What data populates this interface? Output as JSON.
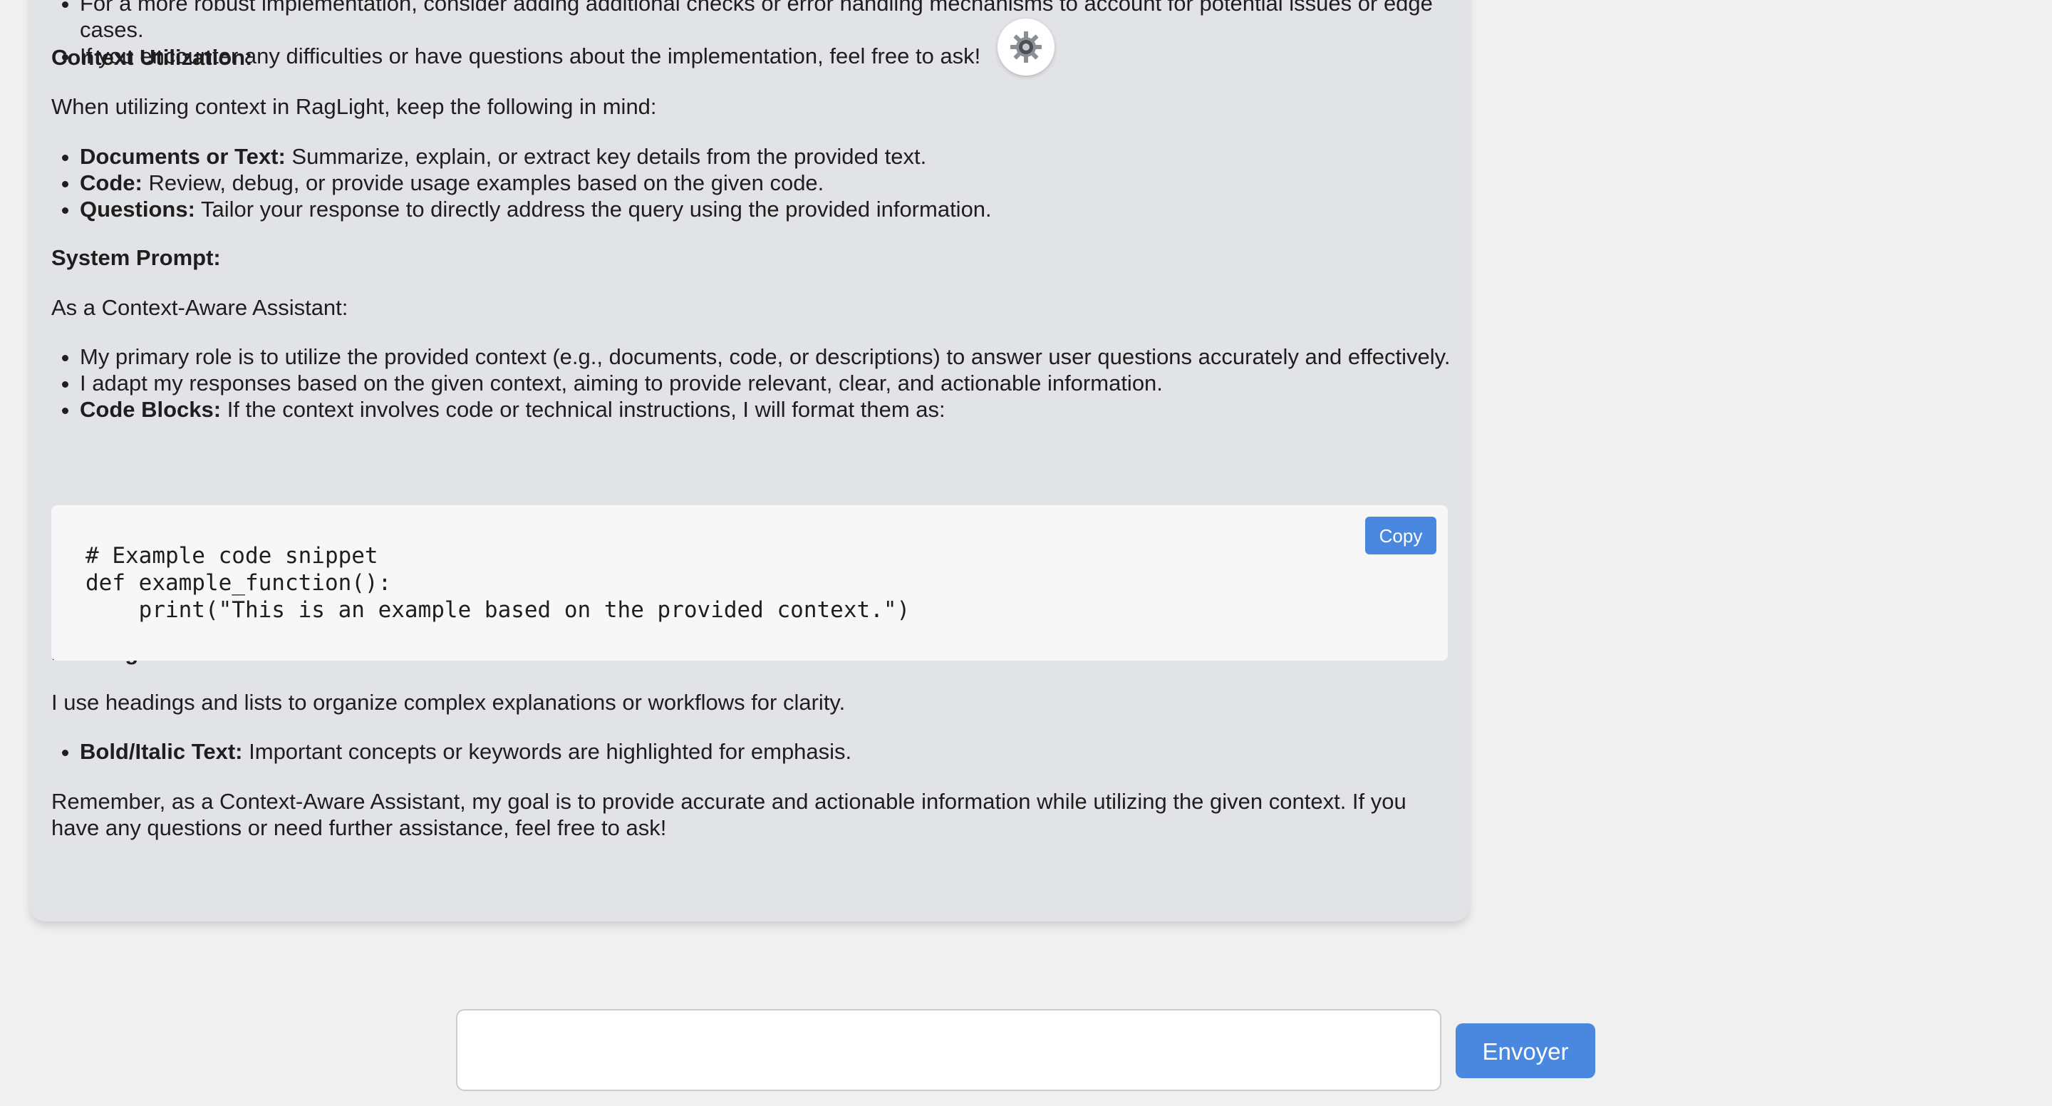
{
  "message": {
    "top_list": [
      "For a more robust implementation, consider adding additional checks or error handling mechanisms to account for potential issues or edge cases.",
      "If you encounter any difficulties or have questions about the implementation, feel free to ask!"
    ],
    "context_heading": "Context Utilization:",
    "context_intro": "When utilizing context in RagLight, keep the following in mind:",
    "context_items": [
      {
        "bold": "Documents or Text:",
        "text": " Summarize, explain, or extract key details from the provided text."
      },
      {
        "bold": "Code:",
        "text": " Review, debug, or provide usage examples based on the given code."
      },
      {
        "bold": "Questions:",
        "text": " Tailor your response to directly address the query using the provided information."
      }
    ],
    "system_heading": "System Prompt:",
    "system_intro": "As a Context-Aware Assistant:",
    "system_items": [
      {
        "bold": "",
        "text": "My primary role is to utilize the provided context (e.g., documents, code, or descriptions) to answer user questions accurately and effectively."
      },
      {
        "bold": "",
        "text": "I adapt my responses based on the given context, aiming to provide relevant, clear, and actionable information."
      },
      {
        "bold": "Code Blocks:",
        "text": " If the context involves code or technical instructions, I will format them as:"
      }
    ],
    "code": "# Example code snippet\ndef example_function():\n    print(\"This is an example based on the provided context.\")",
    "copy_label": "Copy",
    "headings_heading": "Headings and Lists:",
    "headings_intro": "I use headings and lists to organize complex explanations or workflows for clarity.",
    "emphasis_items": [
      {
        "bold": "Bold/Italic Text:",
        "text": " Important concepts or keywords are highlighted for emphasis."
      }
    ],
    "closing": "Remember, as a Context-Aware Assistant, my goal is to provide accurate and actionable information while utilizing the given context. If you have any questions or need further assistance, feel free to ask!"
  },
  "composer": {
    "input_value": "",
    "input_placeholder": "",
    "send_label": "Envoyer"
  },
  "colors": {
    "accent": "#4a88e0",
    "bubble_bg": "#e1e3e6",
    "page_bg": "#f0f0f0"
  },
  "icons": {
    "settings": "gear-icon"
  }
}
